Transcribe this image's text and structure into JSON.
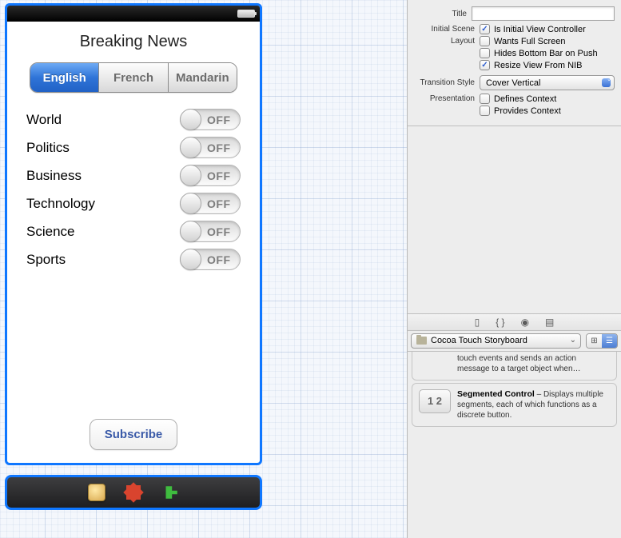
{
  "phone": {
    "heading": "Breaking News",
    "segments": [
      "English",
      "French",
      "Mandarin"
    ],
    "categories": [
      "World",
      "Politics",
      "Business",
      "Technology",
      "Science",
      "Sports"
    ],
    "switch_text": "OFF",
    "subscribe": "Subscribe"
  },
  "inspector": {
    "title_label": "Title",
    "title_value": "",
    "initial_scene_label": "Initial Scene",
    "layout_label": "Layout",
    "check_initial": "Is Initial View Controller",
    "check_full": "Wants Full Screen",
    "check_hidebar": "Hides Bottom Bar on Push",
    "check_resize": "Resize View From NIB",
    "transition_label": "Transition Style",
    "transition_value": "Cover Vertical",
    "presentation_label": "Presentation",
    "check_defines": "Defines Context",
    "check_provides": "Provides Context"
  },
  "library": {
    "filter": "Cocoa Touch Storyboard",
    "item_cut_text": "touch events and sends an action message to a target object when…",
    "item_seg_title": "Segmented Control",
    "item_seg_text": " – Displays multiple segments, each of which functions as a discrete button.",
    "seg_thumb": "1  2"
  }
}
